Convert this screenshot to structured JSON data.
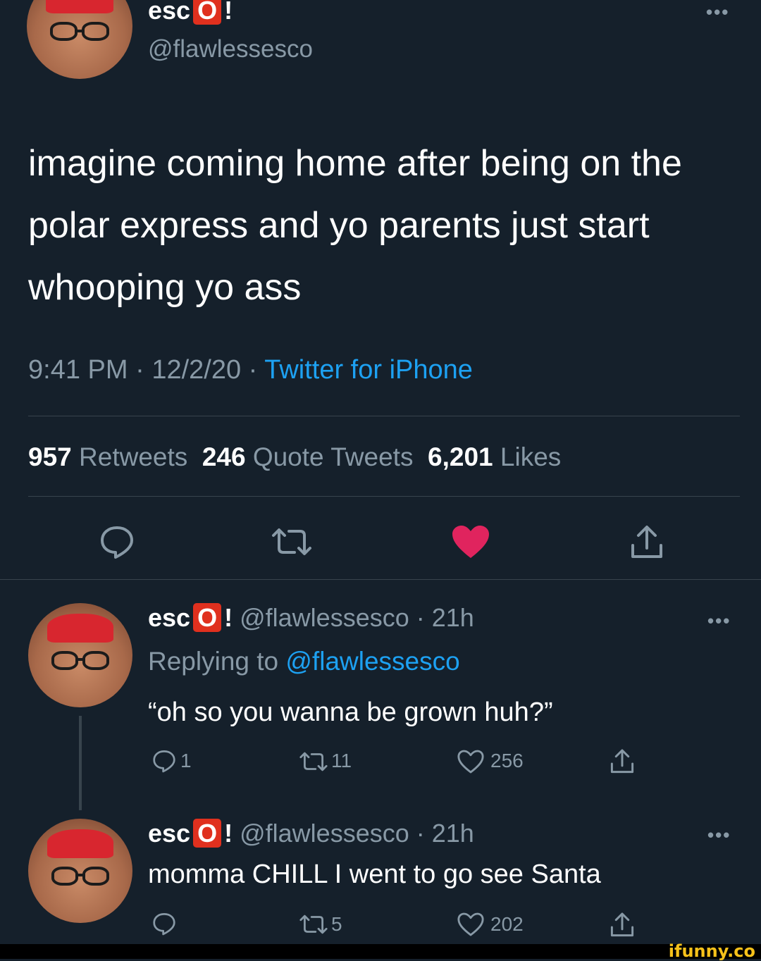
{
  "main_tweet": {
    "display_name_pre": "esc",
    "display_name_box": "O",
    "display_name_post": "!",
    "handle": "@flawlessesco",
    "text": "imagine coming home after being on the polar express and yo parents just start whooping yo ass",
    "time": "9:41 PM",
    "separator": "·",
    "date": "12/2/20",
    "source": "Twitter for iPhone",
    "stats": {
      "retweets_count": "957",
      "retweets_label": "Retweets",
      "quotes_count": "246",
      "quotes_label": "Quote Tweets",
      "likes_count": "6,201",
      "likes_label": "Likes"
    },
    "more": "•••"
  },
  "replies": [
    {
      "display_name_pre": "esc",
      "display_name_box": "O",
      "display_name_post": "!",
      "handle_time": "@flawlessesco · 21h",
      "replying_label": "Replying to",
      "replying_handle": "@flawlessesco",
      "text": "“oh so you wanna be grown huh?”",
      "reply_count": "1",
      "retweet_count": "11",
      "like_count": "256",
      "more": "•••"
    },
    {
      "display_name_pre": "esc",
      "display_name_box": "O",
      "display_name_post": "!",
      "handle_time": "@flawlessesco · 21h",
      "text": "momma CHILL I went to go see Santa",
      "reply_count": "",
      "retweet_count": "5",
      "like_count": "202",
      "more": "•••"
    }
  ],
  "colors": {
    "background": "#15202b",
    "muted": "#8899a6",
    "link": "#1da1f2",
    "like": "#e0245e",
    "name_badge": "#e0301e"
  },
  "icons": [
    "reply-icon",
    "retweet-icon",
    "like-icon",
    "share-icon",
    "more-icon"
  ],
  "watermark": "ifunny.co"
}
